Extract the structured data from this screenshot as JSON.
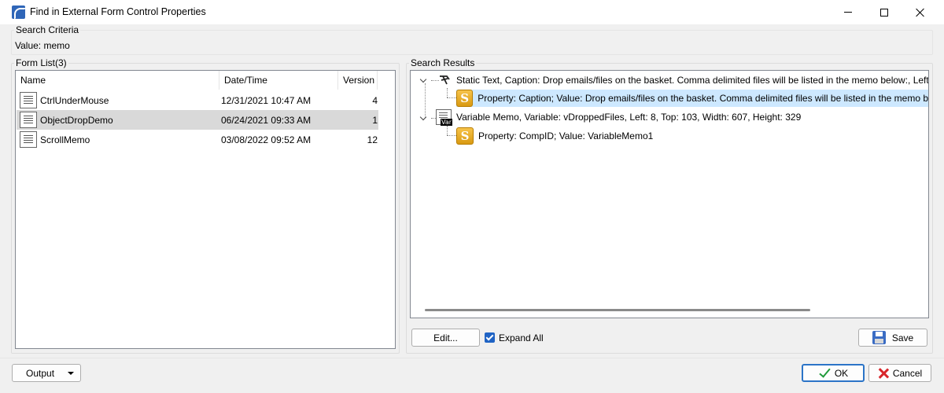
{
  "window": {
    "title": "Find in External Form Control Properties"
  },
  "search_criteria": {
    "legend": "Search Criteria",
    "value_text": "Value: memo"
  },
  "form_list": {
    "legend": "Form List(3)",
    "columns": [
      "Name",
      "Date/Time",
      "Version"
    ],
    "rows": [
      {
        "name": "CtrlUnderMouse",
        "datetime": "12/31/2021 10:47 AM",
        "version": "4"
      },
      {
        "name": "ObjectDropDemo",
        "datetime": "06/24/2021 09:33 AM",
        "version": "1"
      },
      {
        "name": "ScrollMemo",
        "datetime": "03/08/2022 09:52 AM",
        "version": "12"
      }
    ],
    "selected_index": 1
  },
  "search_results": {
    "legend": "Search Results",
    "nodes": [
      {
        "text": "Static Text, Caption: Drop emails/files on the basket. Comma delimited files will be listed in the memo below:, Left"
      },
      {
        "text": "Property: Caption; Value: Drop emails/files on the basket. Comma delimited files will be listed in the memo b"
      },
      {
        "text": "Variable Memo, Variable: vDroppedFiles, Left: 8, Top: 103, Width: 607, Height: 329"
      },
      {
        "text": "Property: CompID; Value: VariableMemo1"
      }
    ],
    "var_tag": "Var",
    "s_glyph": "S"
  },
  "buttons": {
    "edit": "Edit...",
    "expand_all": "Expand All",
    "save": "Save",
    "output": "Output",
    "ok": "OK",
    "cancel": "Cancel"
  },
  "expand_all_checked": true,
  "colors": {
    "selection_tree": "#cde8ff",
    "selection_list": "#d9d9d9",
    "accent": "#1f63c4"
  }
}
